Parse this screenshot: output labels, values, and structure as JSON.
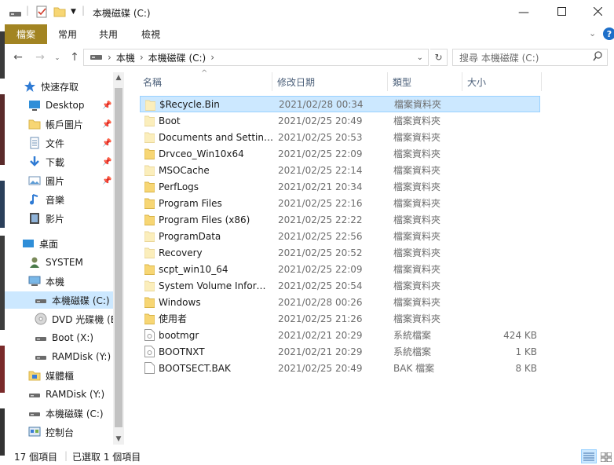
{
  "window": {
    "title": "本機磁碟 (C:)",
    "minimize_icon": "minimize-icon",
    "maximize_icon": "maximize-icon",
    "close_icon": "close-icon"
  },
  "ribbon": {
    "tabs": [
      "檔案",
      "常用",
      "共用",
      "檢視"
    ],
    "accent": "#a28422"
  },
  "address": {
    "path": [
      "本機",
      "本機磁碟 (C:)"
    ],
    "search_placeholder": "搜尋 本機磁碟 (C:)"
  },
  "nav": {
    "quick_access": "快速存取",
    "pinned": [
      "Desktop",
      "帳戶圖片",
      "文件",
      "下載",
      "圖片"
    ],
    "unpinned": [
      "音樂",
      "影片"
    ],
    "desktop": "桌面",
    "system": "SYSTEM",
    "this_pc": "本機",
    "drives": [
      "本機磁碟 (C:)",
      "DVD 光碟機 (E",
      "Boot (X:)",
      "RAMDisk (Y:)"
    ],
    "libraries": "媒體櫃",
    "ramdisk": "RAMDisk (Y:)",
    "c_drive": "本機磁碟 (C:)",
    "control_panel": "控制台"
  },
  "columns": {
    "name": "名稱",
    "date": "修改日期",
    "type": "類型",
    "size": "大小"
  },
  "files": [
    {
      "name": "$Recycle.Bin",
      "date": "2021/02/28 00:34",
      "type": "檔案資料夾",
      "size": "",
      "kind": "folder-faded",
      "selected": true
    },
    {
      "name": "Boot",
      "date": "2021/02/25 20:49",
      "type": "檔案資料夾",
      "size": "",
      "kind": "folder-faded"
    },
    {
      "name": "Documents and Settings",
      "date": "2021/02/25 20:53",
      "type": "檔案資料夾",
      "size": "",
      "kind": "folder-faded"
    },
    {
      "name": "Drvceo_Win10x64",
      "date": "2021/02/25 22:09",
      "type": "檔案資料夾",
      "size": "",
      "kind": "folder"
    },
    {
      "name": "MSOCache",
      "date": "2021/02/25 22:14",
      "type": "檔案資料夾",
      "size": "",
      "kind": "folder-faded"
    },
    {
      "name": "PerfLogs",
      "date": "2021/02/21 20:34",
      "type": "檔案資料夾",
      "size": "",
      "kind": "folder"
    },
    {
      "name": "Program Files",
      "date": "2021/02/25 22:16",
      "type": "檔案資料夾",
      "size": "",
      "kind": "folder"
    },
    {
      "name": "Program Files (x86)",
      "date": "2021/02/25 22:22",
      "type": "檔案資料夾",
      "size": "",
      "kind": "folder"
    },
    {
      "name": "ProgramData",
      "date": "2021/02/25 22:56",
      "type": "檔案資料夾",
      "size": "",
      "kind": "folder-faded"
    },
    {
      "name": "Recovery",
      "date": "2021/02/25 20:52",
      "type": "檔案資料夾",
      "size": "",
      "kind": "folder-faded"
    },
    {
      "name": "scpt_win10_64",
      "date": "2021/02/25 22:09",
      "type": "檔案資料夾",
      "size": "",
      "kind": "folder"
    },
    {
      "name": "System Volume Inform...",
      "date": "2021/02/25 20:54",
      "type": "檔案資料夾",
      "size": "",
      "kind": "folder-faded"
    },
    {
      "name": "Windows",
      "date": "2021/02/28 00:26",
      "type": "檔案資料夾",
      "size": "",
      "kind": "folder"
    },
    {
      "name": "使用者",
      "date": "2021/02/25 21:26",
      "type": "檔案資料夾",
      "size": "",
      "kind": "folder"
    },
    {
      "name": "bootmgr",
      "date": "2021/02/21 20:29",
      "type": "系統檔案",
      "size": "424 KB",
      "kind": "sysfile"
    },
    {
      "name": "BOOTNXT",
      "date": "2021/02/21 20:29",
      "type": "系統檔案",
      "size": "1 KB",
      "kind": "sysfile"
    },
    {
      "name": "BOOTSECT.BAK",
      "date": "2021/02/25 20:49",
      "type": "BAK 檔案",
      "size": "8 KB",
      "kind": "file"
    }
  ],
  "status": {
    "count": "17 個項目",
    "selected": "已選取 1 個項目"
  }
}
